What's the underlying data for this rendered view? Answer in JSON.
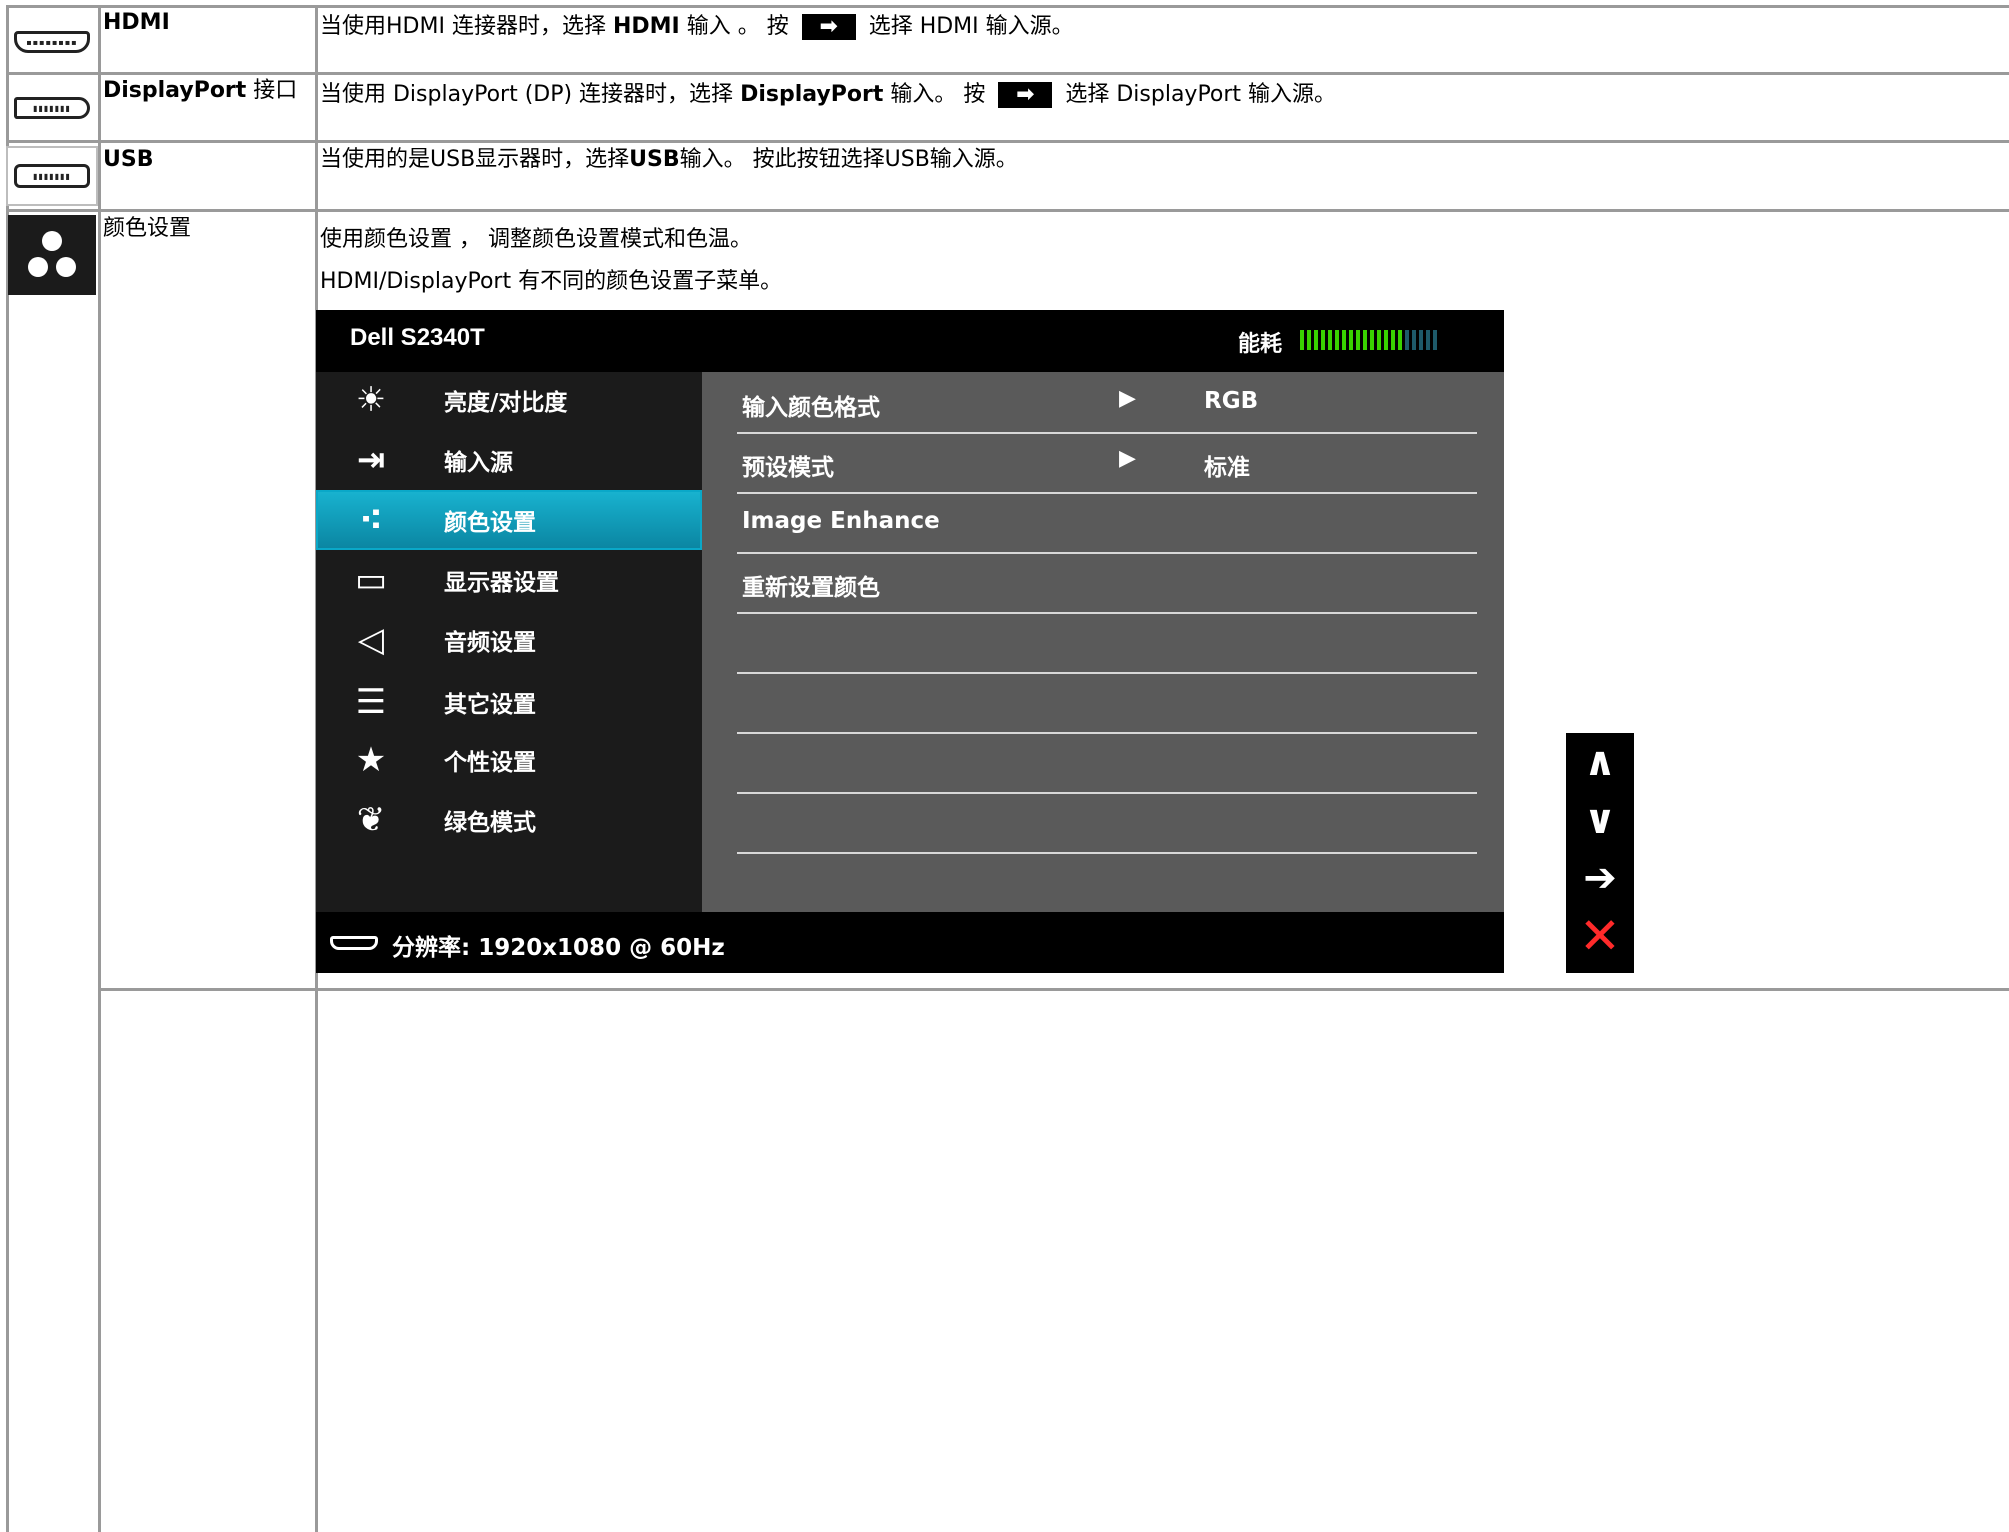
{
  "rows": {
    "hdmi": {
      "icon_text": "▪▪▪▪▪▪▪▪",
      "name": "HDMI",
      "desc_before": "当使用HDMI 连接器时，选择 ",
      "desc_bold": "HDMI",
      "desc_mid": " 输入 。 按 ",
      "desc_after": " 选择 HDMI 输入源。"
    },
    "displayport": {
      "icon_text": "▮▮▮▮▮▮▮",
      "name_bold": "DisplayPort",
      "name_suffix": " 接口",
      "desc_before": "当使用 DisplayPort (DP) 连接器时，选择 ",
      "desc_bold": "DisplayPort",
      "desc_mid": " 输入。 按 ",
      "desc_after": " 选择 DisplayPort 输入源。"
    },
    "usb": {
      "icon_text": "▮▮▮▮▮▮▮",
      "name": "USB",
      "desc_a": "当使用的是USB显示器时，选择",
      "desc_bold": "USB",
      "desc_b": "输入。 按此按钮选择USB输入源。"
    },
    "color": {
      "name": "颜色设置",
      "desc_line1": "使用颜色设置 ， 调整颜色设置模式和色温。",
      "desc_line2": "HDMI/DisplayPort 有不同的颜色设置子菜单。"
    }
  },
  "key_arrow": "➡",
  "osd": {
    "title": "Dell S2340T",
    "energy_label": "能耗",
    "energy_level": 0.75,
    "menu": [
      {
        "icon": "☀",
        "label": "亮度/对比度"
      },
      {
        "icon": "⇥",
        "label": "输入源"
      },
      {
        "icon": "⁖",
        "label": "颜色设置"
      },
      {
        "icon": "▭",
        "label": "显示器设置"
      },
      {
        "icon": "◁",
        "label": "音频设置"
      },
      {
        "icon": "☰",
        "label": "其它设置"
      },
      {
        "icon": "★",
        "label": "个性设置"
      },
      {
        "icon": "❦",
        "label": "绿色模式"
      }
    ],
    "submenu": [
      {
        "label": "输入颜色格式",
        "arrow": "▶",
        "value": "RGB"
      },
      {
        "label": "预设模式",
        "arrow": "▶",
        "value": "标准"
      },
      {
        "label": "Image Enhance",
        "arrow": "",
        "value": ""
      },
      {
        "label": "重新设置颜色",
        "arrow": "",
        "value": ""
      }
    ],
    "resolution": "分辨率: 1920x1080 @ 60Hz"
  },
  "nav": {
    "up": "∧",
    "down": "∨",
    "right": "➔",
    "close": "✕"
  }
}
